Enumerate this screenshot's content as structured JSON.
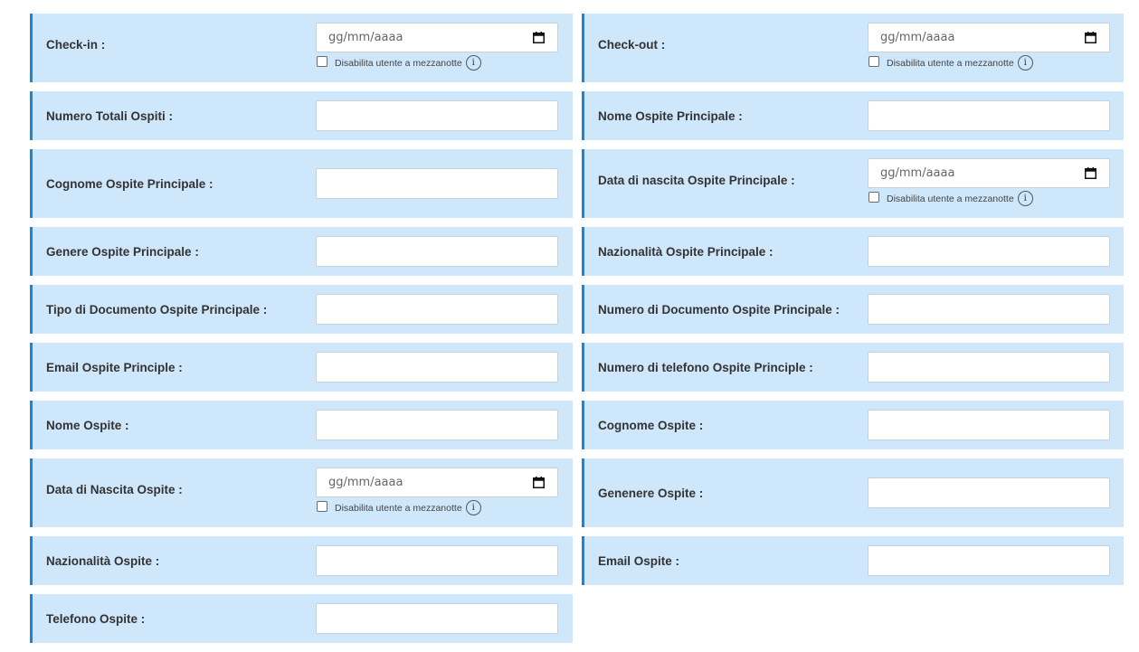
{
  "date_placeholder": "gg/mm/aaaa",
  "midnight_label": "Disabilita utente a mezzanotte",
  "info_glyph": "i",
  "fields": [
    {
      "label": "Check-in :",
      "type": "date"
    },
    {
      "label": "Check-out :",
      "type": "date"
    },
    {
      "label": "Numero Totali Ospiti :",
      "type": "text",
      "value": ""
    },
    {
      "label": "Nome Ospite Principale :",
      "type": "text",
      "value": ""
    },
    {
      "label": "Cognome Ospite Principale :",
      "type": "text",
      "value": ""
    },
    {
      "label": "Data di nascita Ospite Principale :",
      "type": "date"
    },
    {
      "label": "Genere Ospite Principale :",
      "type": "text",
      "value": ""
    },
    {
      "label": "Nazionalità Ospite Principale :",
      "type": "text",
      "value": ""
    },
    {
      "label": "Tipo di Documento Ospite Principale :",
      "type": "text",
      "value": ""
    },
    {
      "label": "Numero di Documento Ospite Principale :",
      "type": "text",
      "value": ""
    },
    {
      "label": "Email Ospite Principle :",
      "type": "text",
      "value": ""
    },
    {
      "label": "Numero di telefono Ospite Principle :",
      "type": "text",
      "value": ""
    },
    {
      "label": "Nome Ospite :",
      "type": "text",
      "value": ""
    },
    {
      "label": "Cognome Ospite :",
      "type": "text",
      "value": ""
    },
    {
      "label": "Data di Nascita Ospite :",
      "type": "date"
    },
    {
      "label": "Genenere Ospite :",
      "type": "text",
      "value": ""
    },
    {
      "label": "Nazionalità Ospite :",
      "type": "text",
      "value": ""
    },
    {
      "label": "Email Ospite :",
      "type": "text",
      "value": ""
    },
    {
      "label": "Telefono Ospite :",
      "type": "text",
      "value": ""
    }
  ],
  "colors": {
    "row_background": "#cfe7fb",
    "row_accent_border": "#1a87d6",
    "label_text": "#333333"
  },
  "icons": {
    "date_picker": "calendar-icon",
    "info": "info-icon"
  }
}
